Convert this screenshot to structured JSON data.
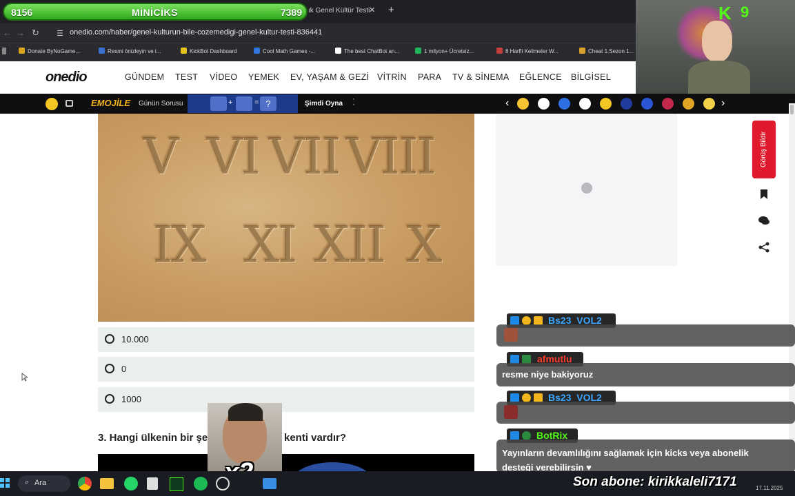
{
  "overlay": {
    "score_left": "8156",
    "score_title": "MİNİCİKS",
    "score_right": "7389",
    "kick_count": "9",
    "subscriber_line": "Son abone: kirikkaleli7171",
    "meme_label": "x2"
  },
  "browser": {
    "tab_title": "ık Genel Kültür Testi",
    "tab_close": "✕",
    "new_tab": "+",
    "url": "onedio.com/haber/genel-kulturun-bile-cozemedigi-genel-kultur-testi-836441",
    "bookmarks": [
      {
        "label": "Donate ByNoGame...",
        "color": "#d9a31a"
      },
      {
        "label": "Resmi önizleyin ve i...",
        "color": "#3b6fd1"
      },
      {
        "label": "KickBot Dashboard",
        "color": "#e4c21b"
      },
      {
        "label": "Cool Math Games -...",
        "color": "#2f76e0"
      },
      {
        "label": "The best ChatBot an...",
        "color": "#ffffff"
      },
      {
        "label": "1 milyon+ Ücretsiz...",
        "color": "#1fb35a"
      },
      {
        "label": "8 Harfli Kelimeler W...",
        "color": "#c43d3d"
      },
      {
        "label": "Cheat 1.Sezon 1...",
        "color": "#d8a12b"
      }
    ]
  },
  "site": {
    "logo": "onedio",
    "nav": [
      "GÜNDEM",
      "TEST",
      "VİDEO",
      "YEMEK",
      "EV, YAŞAM & GEZİ",
      "VİTRİN",
      "PARA",
      "TV & SİNEMA",
      "EĞLENCE",
      "BİLGİSEL"
    ],
    "emoji_bar": {
      "brand": "EMOJİLE",
      "daily": "Günün Sorusu",
      "equals": "=",
      "question": "?",
      "play": "Şimdi Oyna",
      "prev": "‹",
      "next": "›"
    },
    "image_numerals": [
      "V",
      "VI",
      "VII",
      "VIII",
      "IX",
      "XI",
      "XII",
      "X"
    ],
    "options": [
      "10.000",
      "0",
      "1000"
    ],
    "question3": "3. Hangi ülkenin bir şehri",
    "question3_tail": "kenti vardır?",
    "feedback_label": "Görüş Bildir"
  },
  "chat": {
    "messages": [
      {
        "user": "Bs23_VOL2",
        "user_color": "#3da7ff",
        "text": ""
      },
      {
        "user": "afmutlu",
        "user_color": "#ff3b30",
        "text": "resme niye bakiyoruz"
      },
      {
        "user": "Bs23_VOL2",
        "user_color": "#3da7ff",
        "text": ""
      },
      {
        "user": "BotRix",
        "user_color": "#53fc18",
        "text": "Yayınların devamlılığını sağlamak için kicks veya abonelik desteği verebilirsin ♥"
      }
    ]
  },
  "taskbar": {
    "search_label": "Ara",
    "date": "17.11.2025"
  }
}
